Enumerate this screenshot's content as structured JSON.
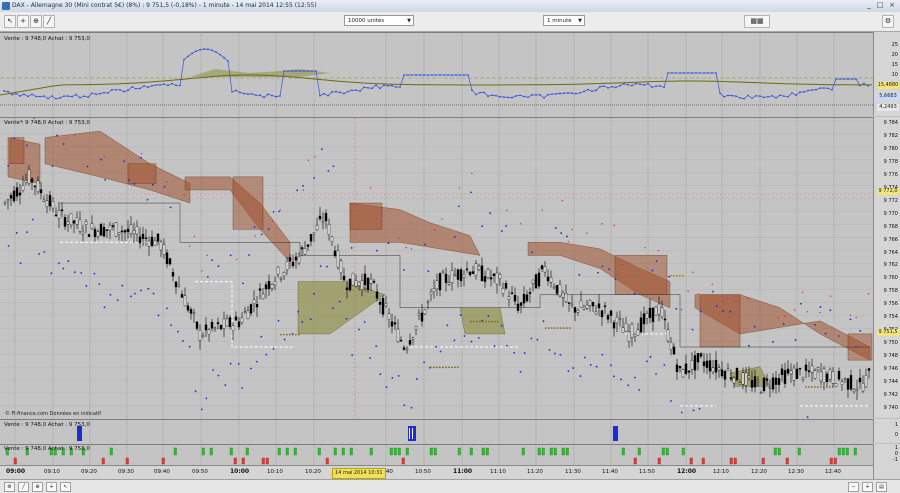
{
  "window": {
    "title": "DAX - Allemagne 30 (Mini contrat 5€) (8%) : 9 751,5 (-0,18%) - 1 minute - 14 mai 2014 12:55 (12:55)",
    "minimize": "_",
    "maximize": "□",
    "close": "×"
  },
  "toolbar": {
    "units_select": "10000 unités",
    "period_select": "1 minute"
  },
  "panels": {
    "top_label": "Vente : 9 748,0 Achat : 9 753,0",
    "main_label": "Vente : 9 748,0 Achat : 9 753,0",
    "vol_label": "Vente : 9 748,0 Achat : 9 753,0",
    "hist_label": "Vente : 9 748,0 Achat : 9 753,0",
    "credit": "© Fi-finance.com Données en indicatif"
  },
  "top_axis": {
    "ticks": [
      "25",
      "20",
      "15",
      "10",
      "5"
    ],
    "boxes": [
      {
        "label": "15,4880",
        "color": "#f2e37a"
      },
      {
        "label": "5,6683",
        "color": "#c8d8ff"
      },
      {
        "label": "4,2493",
        "color": "#e8e8e8"
      }
    ]
  },
  "main_axis": {
    "ticks": [
      "9 784",
      "9 782",
      "9 780",
      "9 778",
      "9 776",
      "9 774",
      "9 772",
      "9 770",
      "9 768",
      "9 766",
      "9 764",
      "9 762",
      "9 760",
      "9 758",
      "9 756",
      "9 754",
      "9 752",
      "9 750",
      "9 748",
      "9 746",
      "9 744",
      "9 742",
      "9 740"
    ],
    "current_price": "9 751,5",
    "cursor_price": "9 772,0",
    "range": [
      9739,
      9785
    ]
  },
  "vol_axis": {
    "ticks": [
      "1",
      "0"
    ]
  },
  "hist_axis": {
    "ticks": [
      "1",
      "0",
      "-1"
    ]
  },
  "time_axis": {
    "labels": [
      {
        "text": "09:00",
        "bold": true
      },
      {
        "text": "09:10",
        "bold": false
      },
      {
        "text": "09:20",
        "bold": false
      },
      {
        "text": "09:30",
        "bold": false
      },
      {
        "text": "09:40",
        "bold": false
      },
      {
        "text": "09:50",
        "bold": false
      },
      {
        "text": "10:00",
        "bold": true
      },
      {
        "text": "10:10",
        "bold": false
      },
      {
        "text": "10:20",
        "bold": false
      },
      {
        "text": "10:40",
        "bold": false
      },
      {
        "text": "10:50",
        "bold": false
      },
      {
        "text": "11:00",
        "bold": true
      },
      {
        "text": "11:10",
        "bold": false
      },
      {
        "text": "11:20",
        "bold": false
      },
      {
        "text": "11:30",
        "bold": false
      },
      {
        "text": "11:40",
        "bold": false
      },
      {
        "text": "11:50",
        "bold": false
      },
      {
        "text": "12:00",
        "bold": true
      },
      {
        "text": "12:10",
        "bold": false
      },
      {
        "text": "12:20",
        "bold": false
      },
      {
        "text": "12:30",
        "bold": false
      },
      {
        "text": "12:40",
        "bold": false
      }
    ],
    "date_badge": "14 mai 2014 10:31"
  },
  "colors": {
    "candle": "#000000",
    "cloud": "#a0522d",
    "olive": "#8a8a3a",
    "dot_blue": "#1a2dd8",
    "dot_red": "#c0304a",
    "vol_bar": "#1a2dd8"
  },
  "icons": [
    "app-icon",
    "cursor-icon",
    "crosshair-icon",
    "zoom-icon",
    "line-icon",
    "settings-icon",
    "layout-icon"
  ]
}
